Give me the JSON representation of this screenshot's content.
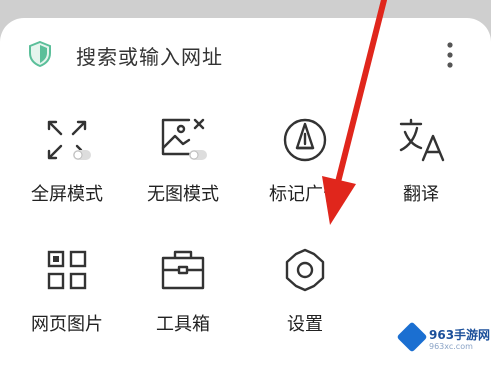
{
  "search": {
    "text": "搜索或输入网址",
    "shield_icon": "shield-icon",
    "more_icon": "more-vertical-icon"
  },
  "menu": {
    "items": [
      {
        "label": "全屏模式",
        "icon": "fullscreen-icon"
      },
      {
        "label": "无图模式",
        "icon": "no-image-icon"
      },
      {
        "label": "标记广告",
        "icon": "pen-nib-icon"
      },
      {
        "label": "翻译",
        "icon": "translate-icon"
      },
      {
        "label": "网页图片",
        "icon": "web-images-icon"
      },
      {
        "label": "工具箱",
        "icon": "toolbox-icon"
      },
      {
        "label": "设置",
        "icon": "settings-gear-icon"
      }
    ]
  },
  "watermark": {
    "brand": "963手游网",
    "domain": "963xc.com"
  },
  "colors": {
    "arrow": "#e0261c",
    "shield": "#5bbf9a",
    "icon": "#333333"
  }
}
